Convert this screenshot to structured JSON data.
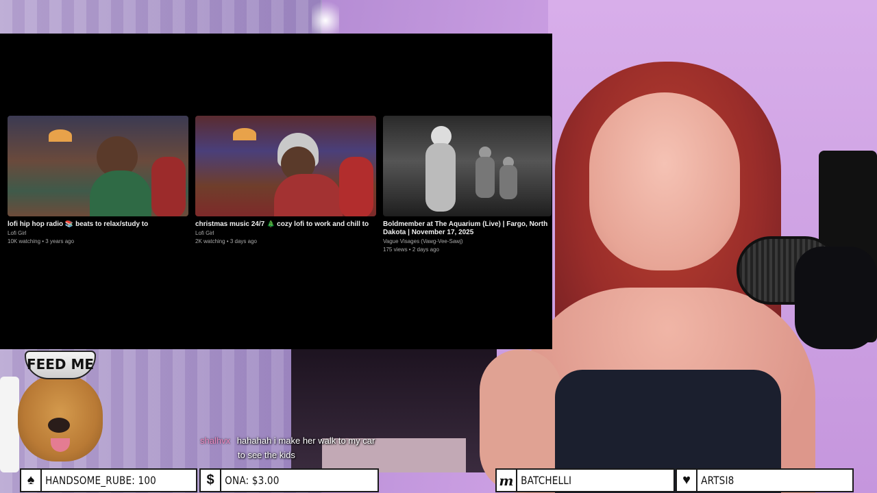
{
  "videos": [
    {
      "title": "lofi hip hop radio 📚 beats to relax/study to",
      "channel": "Lofi Girl",
      "meta": "10K watching • 3 years ago"
    },
    {
      "title": "christmas music 24/7 🎄 cozy lofi to work and chill to",
      "channel": "Lofi Girl",
      "meta": "2K watching • 3 days ago"
    },
    {
      "title": "Boldmember at The Aquarium (Live) | Fargo, North Dakota | November 17, 2025",
      "channel": "Vague Visages (Vawg-Vee-Sawj)",
      "meta": "175 views • 2 days ago"
    }
  ],
  "sticker": {
    "text": "FEED ME"
  },
  "chat": {
    "username": "shalhvx",
    "message_line1": "hahahah i make her walk to my car",
    "message_line2": "to see the kids"
  },
  "alerts": [
    {
      "icon": "spade-icon",
      "glyph": "♠",
      "text": "HANDSOME_RUBE: 100"
    },
    {
      "icon": "dollar-icon",
      "glyph": "$",
      "text": "ONA: $3.00"
    },
    {
      "icon": "m-icon",
      "glyph": "m",
      "text": "BATCHELLI"
    },
    {
      "icon": "heart-icon",
      "glyph": "♥",
      "text": "ARTSI8"
    }
  ]
}
